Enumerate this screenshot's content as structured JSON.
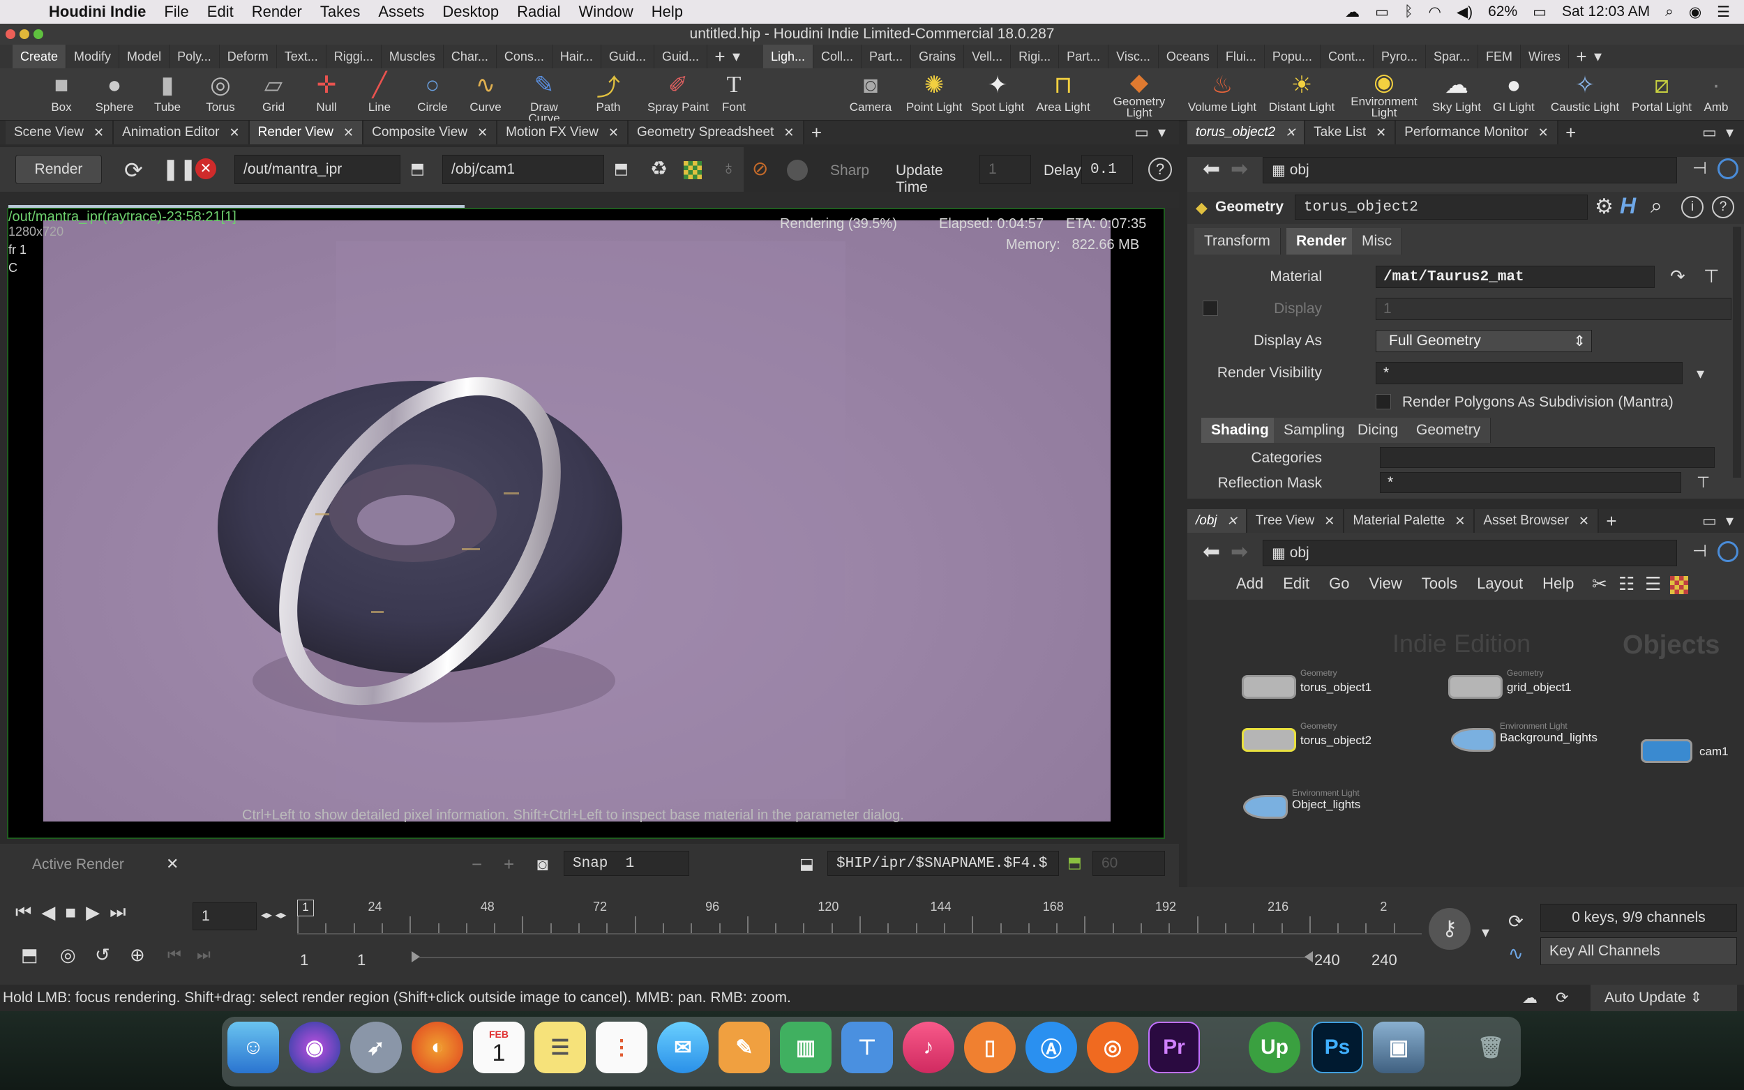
{
  "menubar": {
    "app": "Houdini Indie",
    "items": [
      "File",
      "Edit",
      "Render",
      "Takes",
      "Assets",
      "Desktop",
      "Radial",
      "Window",
      "Help"
    ],
    "battery": "62%",
    "clock": "Sat 12:03 AM"
  },
  "window_title": "untitled.hip - Houdini Indie Limited-Commercial 18.0.287",
  "shelf_tabs_left": [
    "Create",
    "Modify",
    "Model",
    "Poly...",
    "Deform",
    "Text...",
    "Riggi...",
    "Muscles",
    "Char...",
    "Cons...",
    "Hair...",
    "Guid...",
    "Guid..."
  ],
  "shelf_tabs_right": [
    "Ligh...",
    "Coll...",
    "Part...",
    "Grains",
    "Vell...",
    "Rigi...",
    "Part...",
    "Visc...",
    "Oceans",
    "Flui...",
    "Popu...",
    "Cont...",
    "Pyro...",
    "Spar...",
    "FEM",
    "Wires"
  ],
  "shelf_tools_left": [
    "Box",
    "Sphere",
    "Tube",
    "Torus",
    "Grid",
    "Null",
    "Line",
    "Circle",
    "Curve",
    "Draw Curve",
    "Path",
    "Spray Paint",
    "Font"
  ],
  "shelf_tools_right": [
    "Camera",
    "Point Light",
    "Spot Light",
    "Area Light",
    "Geometry Light",
    "Volume Light",
    "Distant Light",
    "Environment Light",
    "Sky Light",
    "GI Light",
    "Caustic Light",
    "Portal Light",
    "Amb"
  ],
  "viewer_tabs": [
    "Scene View",
    "Animation Editor",
    "Render View",
    "Composite View",
    "Motion FX View",
    "Geometry Spreadsheet"
  ],
  "render_toolbar": {
    "render_label": "Render",
    "output": "/out/mantra_ipr",
    "camera": "/obj/cam1",
    "sharp": "Sharp",
    "update_time_label": "Update Time",
    "update_time": "1",
    "delay_label": "Delay",
    "delay": "0.1"
  },
  "render": {
    "snapshot": "/out/mantra_ipr(raytrace)-23:58:21[1]",
    "resolution": "1280x720",
    "frame": "fr 1",
    "channel": "C",
    "status": "Rendering (39.5%)",
    "elapsed": "Elapsed: 0:04:57",
    "eta": "ETA: 0:07:35",
    "memory": "Memory:   822.66 MB",
    "progress": 0.395,
    "hint": "Ctrl+Left to show detailed pixel information. Shift+Ctrl+Left to inspect base material in the parameter dialog."
  },
  "render_bottom": {
    "active_render": "Active Render",
    "snap_label": "Snap",
    "snap_value": "1",
    "path": "$HIP/ipr/$SNAPNAME.$F4.$",
    "num": "60"
  },
  "param_tabs": [
    "torus_object2",
    "Take List",
    "Performance Monitor"
  ],
  "params": {
    "path": "obj",
    "type": "Geometry",
    "name": "torus_object2",
    "tabs": [
      "Transform",
      "Render",
      "Misc"
    ],
    "material_label": "Material",
    "material": "/mat/Taurus2_mat",
    "display_label": "Display",
    "display": "1",
    "display_as_label": "Display As",
    "display_as": "Full Geometry",
    "render_vis_label": "Render Visibility",
    "render_vis": "*",
    "subdiv_label": "Render Polygons As Subdivision (Mantra)",
    "subtabs": [
      "Shading",
      "Sampling",
      "Dicing",
      "Geometry"
    ],
    "categories_label": "Categories",
    "categories": "",
    "refl_label": "Reflection Mask",
    "refl": "*"
  },
  "network_tabs": [
    "/obj",
    "Tree View",
    "Material Palette",
    "Asset Browser"
  ],
  "network": {
    "path": "obj",
    "menu": [
      "Add",
      "Edit",
      "Go",
      "View",
      "Tools",
      "Layout",
      "Help"
    ],
    "watermark": "Indie Edition",
    "context": "Objects",
    "nodes": [
      {
        "type": "Geometry",
        "name": "torus_object1"
      },
      {
        "type": "Geometry",
        "name": "grid_object1"
      },
      {
        "type": "Geometry",
        "name": "torus_object2"
      },
      {
        "type": "Environment Light",
        "name": "Background_lights"
      },
      {
        "type": "",
        "name": "cam1"
      },
      {
        "type": "Environment Light",
        "name": "Object_lights"
      }
    ]
  },
  "timeline": {
    "frame": "1",
    "ticks": [
      "24",
      "48",
      "72",
      "96",
      "120",
      "144",
      "168",
      "192",
      "216",
      "2"
    ],
    "start": "1",
    "start2": "1",
    "end": "240",
    "end2": "240",
    "keys": "0 keys, 9/9 channels",
    "key_all": "Key All Channels",
    "auto_update": "Auto Update",
    "first_tick": "1"
  },
  "status": "Hold LMB: focus rendering. Shift+drag: select render region (Shift+click outside image to cancel). MMB: pan. RMB: zoom.",
  "dock": {
    "calendar_month": "FEB",
    "calendar_day": "1",
    "pr": "Pr",
    "ps": "Ps",
    "up": "Up"
  }
}
